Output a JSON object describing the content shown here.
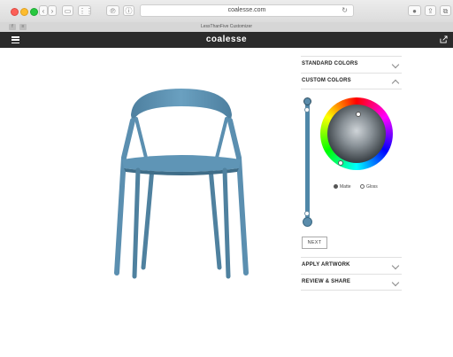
{
  "browser": {
    "url": "coalesse.com",
    "tab_title": "LessThanFive Customizer"
  },
  "site": {
    "brand": "coalesse"
  },
  "customizer": {
    "sections_top": [
      {
        "label": "STANDARD COLORS",
        "expanded": false
      },
      {
        "label": "CUSTOM COLORS",
        "expanded": true
      }
    ],
    "finish_options": [
      {
        "label": "Matte",
        "selected": true
      },
      {
        "label": "Gloss",
        "selected": false
      }
    ],
    "next_label": "NEXT",
    "sections_bottom": [
      {
        "label": "APPLY ARTWORK",
        "expanded": false
      },
      {
        "label": "REVIEW & SHARE",
        "expanded": false
      }
    ],
    "chair_color": "#5b8fb0"
  }
}
